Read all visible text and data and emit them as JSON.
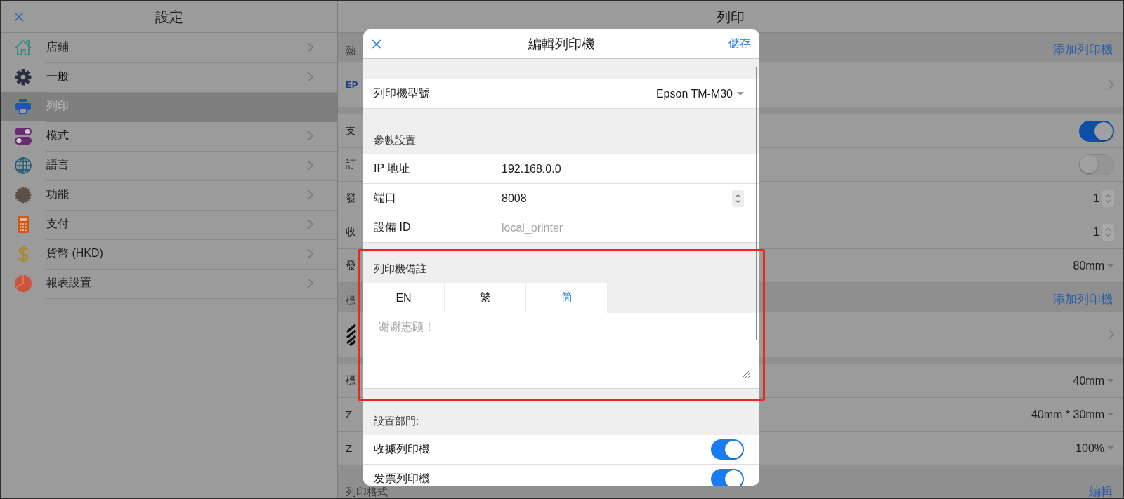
{
  "sidebar": {
    "title": "設定",
    "items": [
      {
        "kind": "home",
        "label": "店鋪",
        "selected": false
      },
      {
        "kind": "gear",
        "label": "一般",
        "selected": false
      },
      {
        "kind": "printer",
        "label": "列印",
        "selected": true
      },
      {
        "kind": "toggles",
        "label": "模式",
        "selected": false
      },
      {
        "kind": "globe",
        "label": "語言",
        "selected": false
      },
      {
        "kind": "seal",
        "label": "功能",
        "selected": false
      },
      {
        "kind": "calculator",
        "label": "支付",
        "selected": false
      },
      {
        "kind": "dollar",
        "label": "貨幣 (HKD)",
        "selected": false
      },
      {
        "kind": "pie",
        "label": "報表設置",
        "selected": false
      }
    ]
  },
  "main": {
    "title": "列印",
    "sections": [
      {
        "label": "熱",
        "action": "添加列印機",
        "rows": [
          {
            "kind": "logo",
            "label": "EP"
          },
          {
            "kind": "gap"
          },
          {
            "kind": "toggle",
            "label": "支",
            "on": true
          },
          {
            "kind": "toggle",
            "label": "訂",
            "on": false
          },
          {
            "kind": "stepper",
            "label": "發",
            "value": "1"
          },
          {
            "kind": "stepper",
            "label": "收",
            "value": "1"
          },
          {
            "kind": "select",
            "label": "發",
            "value": "80mm"
          }
        ]
      },
      {
        "label": "標",
        "action": "添加列印機",
        "rows": [
          {
            "kind": "stripes"
          },
          {
            "kind": "gap"
          },
          {
            "kind": "select",
            "label": "標",
            "value": "40mm"
          },
          {
            "kind": "select",
            "label": "Z",
            "value": "40mm * 30mm"
          },
          {
            "kind": "select",
            "label": "Z",
            "value": "100%"
          }
        ]
      },
      {
        "label": "列印格式",
        "action": "編輯"
      }
    ]
  },
  "dialog": {
    "title": "編輯列印機",
    "save": "儲存",
    "model": {
      "label": "列印機型號",
      "value": "Epson TM-M30"
    },
    "params_heading": "參數設置",
    "fields": [
      {
        "kind": "text",
        "label": "IP 地址",
        "value": "192.168.0.0"
      },
      {
        "kind": "number",
        "label": "端口",
        "value": "8008"
      },
      {
        "kind": "text",
        "label": "設備 ID",
        "placeholder": "local_printer"
      }
    ],
    "note": {
      "heading": "列印機備註",
      "tabs": [
        {
          "label": "EN",
          "selected": false
        },
        {
          "label": "繁",
          "selected": false
        },
        {
          "label": "简",
          "selected": true
        }
      ],
      "placeholder": "谢谢惠顾！"
    },
    "departments": {
      "heading": "設置部門:",
      "items": [
        {
          "label": "收據列印機",
          "on": true
        },
        {
          "label": "发票列印機",
          "on": true
        }
      ]
    }
  }
}
